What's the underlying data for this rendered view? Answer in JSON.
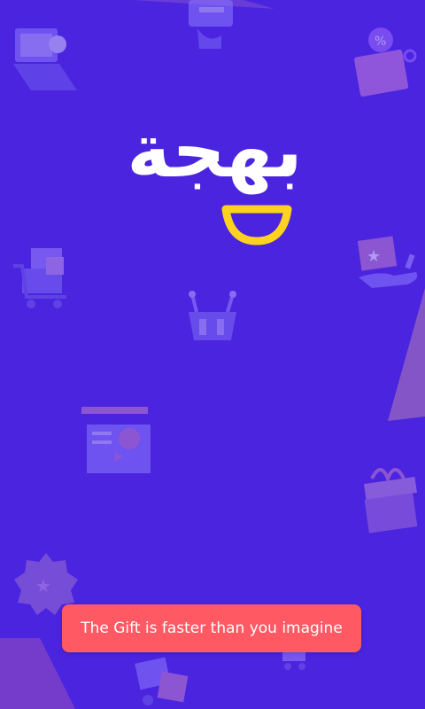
{
  "app": {
    "logo_text": "بهجة",
    "tagline": "The Gift is faster than you imagine"
  },
  "colors": {
    "background": "#4B24DF",
    "logo_text": "#FFFFFF",
    "logo_smile": "#FFD21F",
    "toast_background": "#FF5A64",
    "toast_text": "#FFFFFF"
  },
  "icons": [
    "laptop-icon",
    "card-payment-icon",
    "discount-tag-icon",
    "shopping-cart-icon",
    "gift-card-hand-icon",
    "shopping-basket-icon",
    "web-shop-icon",
    "gift-box-icon",
    "badge-icon",
    "delivery-icon"
  ]
}
